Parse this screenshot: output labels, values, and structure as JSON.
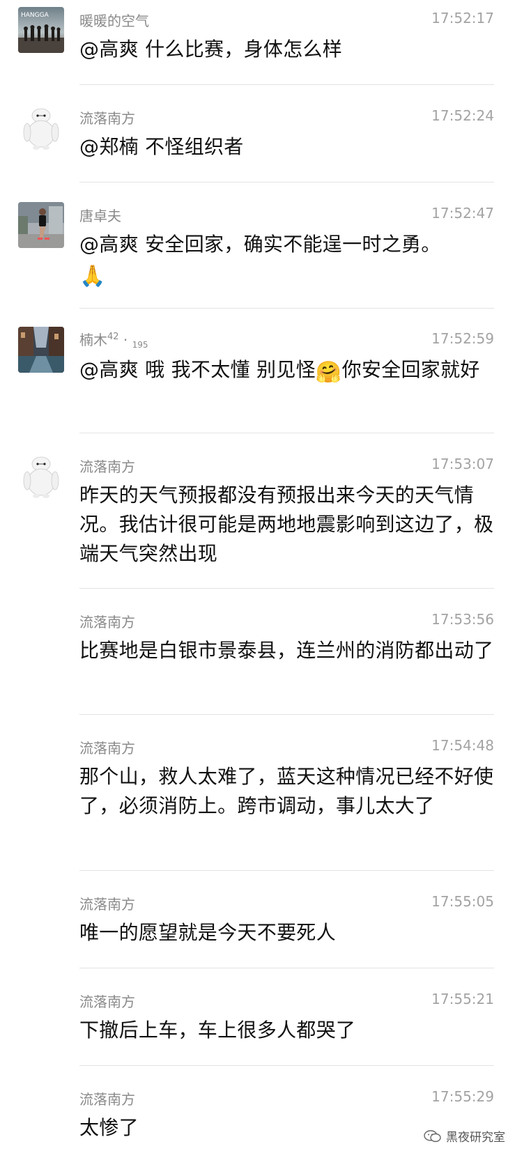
{
  "messages": [
    {
      "sender": "暖暖的空气",
      "time": "17:52:17",
      "text": "@高爽 什么比赛，身体怎么样",
      "avatar": "avatar-photo-group"
    },
    {
      "sender": "流落南方",
      "time": "17:52:24",
      "text": "@郑楠 不怪组织者",
      "avatar": "baymax"
    },
    {
      "sender": "唐卓夫",
      "time": "17:52:47",
      "text": "@高爽 安全回家，确实不能逞一时之勇。",
      "emoji": "🙏",
      "avatar": "avatar-runner"
    },
    {
      "sender": "楠木",
      "sender_sup": "42",
      "sender_sub": "195",
      "time": "17:52:59",
      "text1": "@高爽 哦 我不太懂 别见怪",
      "emoji": "🤗",
      "text2": "你安全回家就好",
      "avatar": "avatar-street"
    },
    {
      "sender": "流落南方",
      "time": "17:53:07",
      "text": "昨天的天气预报都没有预报出来今天的天气情况。我估计很可能是两地地震影响到这边了，极端天气突然出现",
      "avatar": "baymax"
    },
    {
      "sender": "流落南方",
      "time": "17:53:56",
      "text": "比赛地是白银市景泰县，连兰州的消防都出动了"
    },
    {
      "sender": "流落南方",
      "time": "17:54:48",
      "text": "那个山，救人太难了，蓝天这种情况已经不好使了，必须消防上。跨市调动，事儿太大了"
    },
    {
      "sender": "流落南方",
      "time": "17:55:05",
      "text": "唯一的愿望就是今天不要死人"
    },
    {
      "sender": "流落南方",
      "time": "17:55:21",
      "text": "下撤后上车，车上很多人都哭了"
    },
    {
      "sender": "流落南方",
      "time": "17:55:29",
      "text": "太惨了"
    }
  ],
  "avatar_text": "HANGGA",
  "watermark": "黑夜研究室",
  "colors": {
    "sender": "#8a8a8a",
    "time": "#a3a3a3",
    "text": "#111111",
    "divider": "#e3e3e3"
  }
}
